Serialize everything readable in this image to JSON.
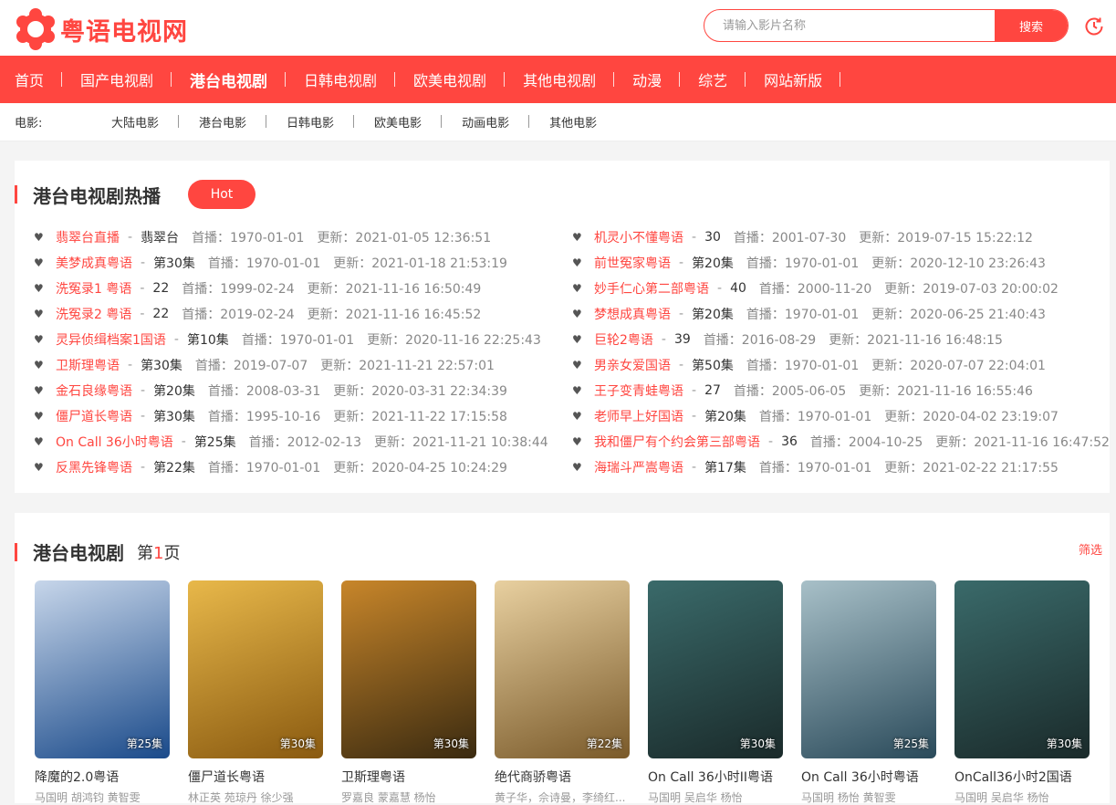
{
  "logo": {
    "text": "粤语电视网"
  },
  "search": {
    "placeholder": "请输入影片名称",
    "button": "搜索"
  },
  "nav": [
    {
      "label": "首页"
    },
    {
      "label": "国产电视剧"
    },
    {
      "label": "港台电视剧",
      "active": true
    },
    {
      "label": "日韩电视剧"
    },
    {
      "label": "欧美电视剧"
    },
    {
      "label": "其他电视剧"
    },
    {
      "label": "动漫"
    },
    {
      "label": "综艺"
    },
    {
      "label": "网站新版"
    }
  ],
  "subnav": {
    "label": "电影:",
    "items": [
      "大陆电影",
      "港台电影",
      "日韩电影",
      "欧美电影",
      "动画电影",
      "其他电影"
    ]
  },
  "hot": {
    "title": "港台电视剧热播",
    "badge": "Hot",
    "left": [
      {
        "title": "翡翠台直播",
        "ep": "翡翠台",
        "premiere": "首播：1970-01-01",
        "update": "更新：2021-01-05 12:36:51"
      },
      {
        "title": "美梦成真粤语",
        "ep": "第30集",
        "premiere": "首播：1970-01-01",
        "update": "更新：2021-01-18 21:53:19"
      },
      {
        "title": "洗冤录1 粤语",
        "ep": "22",
        "premiere": "首播：1999-02-24",
        "update": "更新：2021-11-16 16:50:49"
      },
      {
        "title": "洗冤录2 粤语",
        "ep": "22",
        "premiere": "首播：2019-02-24",
        "update": "更新：2021-11-16 16:45:52"
      },
      {
        "title": "灵异侦缉档案1国语",
        "ep": "第10集",
        "premiere": "首播：1970-01-01",
        "update": "更新：2020-11-16 22:25:43"
      },
      {
        "title": "卫斯理粤语",
        "ep": "第30集",
        "premiere": "首播：2019-07-07",
        "update": "更新：2021-11-21 22:57:01"
      },
      {
        "title": "金石良缘粤语",
        "ep": "第20集",
        "premiere": "首播：2008-03-31",
        "update": "更新：2020-03-31 22:34:39"
      },
      {
        "title": "僵尸道长粤语",
        "ep": "第30集",
        "premiere": "首播：1995-10-16",
        "update": "更新：2021-11-22 17:15:58"
      },
      {
        "title": "On Call 36小时粤语",
        "ep": "第25集",
        "premiere": "首播：2012-02-13",
        "update": "更新：2021-11-21 10:38:44"
      },
      {
        "title": "反黑先锋粤语",
        "ep": "第22集",
        "premiere": "首播：1970-01-01",
        "update": "更新：2020-04-25 10:24:29"
      }
    ],
    "right": [
      {
        "title": "机灵小不懂粤语",
        "ep": "30",
        "premiere": "首播：2001-07-30",
        "update": "更新：2019-07-15 15:22:12"
      },
      {
        "title": "前世冤家粤语",
        "ep": "第20集",
        "premiere": "首播：1970-01-01",
        "update": "更新：2020-12-10 23:26:43"
      },
      {
        "title": "妙手仁心第二部粤语",
        "ep": "40",
        "premiere": "首播：2000-11-20",
        "update": "更新：2019-07-03 20:00:02"
      },
      {
        "title": "梦想成真粤语",
        "ep": "第20集",
        "premiere": "首播：1970-01-01",
        "update": "更新：2020-06-25 21:40:43"
      },
      {
        "title": "巨轮2粤语",
        "ep": "39",
        "premiere": "首播：2016-08-29",
        "update": "更新：2021-11-16 16:48:15"
      },
      {
        "title": "男亲女爱国语",
        "ep": "第50集",
        "premiere": "首播：1970-01-01",
        "update": "更新：2020-07-07 22:04:01"
      },
      {
        "title": "王子变青蛙粤语",
        "ep": "27",
        "premiere": "首播：2005-06-05",
        "update": "更新：2021-11-16 16:55:46"
      },
      {
        "title": "老师早上好国语",
        "ep": "第20集",
        "premiere": "首播：1970-01-01",
        "update": "更新：2020-04-02 23:19:07"
      },
      {
        "title": "我和僵尸有个约会第三部粤语",
        "ep": "36",
        "premiere": "首播：2004-10-25",
        "update": "更新：2021-11-16 16:47:52"
      },
      {
        "title": "海瑞斗严嵩粤语",
        "ep": "第17集",
        "premiere": "首播：1970-01-01",
        "update": "更新：2021-02-22 21:17:55"
      }
    ]
  },
  "list": {
    "title": "港台电视剧",
    "page_prefix": "第",
    "page_num": "1",
    "page_suffix": "页",
    "filter": "筛选",
    "cards": [
      {
        "title": "降魔的2.0粤语",
        "cast": "马国明  胡鸿钧  黄智雯",
        "ep": "第25集",
        "color1": "#1a4a8a",
        "color2": "#c7d6ea"
      },
      {
        "title": "僵尸道长粤语",
        "cast": "林正英  苑琼丹  徐少强",
        "ep": "第30集",
        "color1": "#8a5a10",
        "color2": "#e8b84a"
      },
      {
        "title": "卫斯理粤语",
        "cast": "罗嘉良  蒙嘉慧  杨怡",
        "ep": "第30集",
        "color1": "#3a2a10",
        "color2": "#c8862a"
      },
      {
        "title": "绝代商骄粤语",
        "cast": "黄子华，佘诗曼，李绮红...",
        "ep": "第22集",
        "color1": "#7a5a2a",
        "color2": "#e8d0a0"
      },
      {
        "title": "On Call 36小时II粤语",
        "cast": "马国明  吴启华  杨怡",
        "ep": "第30集",
        "color1": "#1a2a2a",
        "color2": "#3a6a6a"
      },
      {
        "title": "On Call 36小时粤语",
        "cast": "马国明  杨怡  黄智雯",
        "ep": "第25集",
        "color1": "#2a4a5a",
        "color2": "#a8c0c8"
      },
      {
        "title": "OnCall36小时2国语",
        "cast": "马国明  吴启华  杨怡",
        "ep": "第30集",
        "color1": "#1a2a2a",
        "color2": "#3a6a6a"
      }
    ]
  }
}
